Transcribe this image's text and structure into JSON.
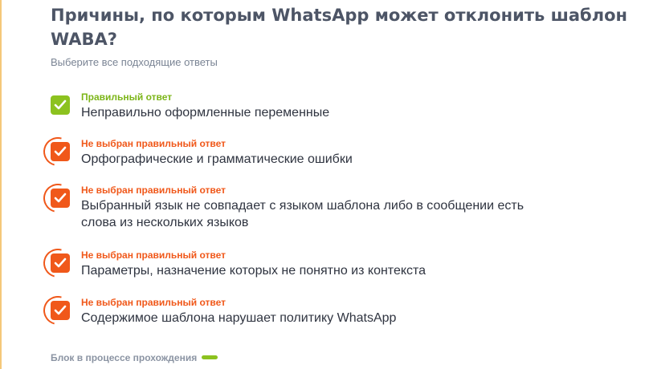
{
  "question": {
    "title": "Причины, по которым WhatsApp может отклонить шаблон WABA?",
    "instruction": "Выберите все подходящие ответы"
  },
  "answers": [
    {
      "status": "Правильный ответ",
      "text": "Неправильно оформленные переменные",
      "state": "correct"
    },
    {
      "status": "Не выбран правильный ответ",
      "text": "Орфографические и грамматические ошибки",
      "state": "missed"
    },
    {
      "status": "Не выбран правильный ответ",
      "text": "Выбранный язык не совпадает с языком шаблона либо в сообщении есть слова из нескольких языков",
      "state": "missed"
    },
    {
      "status": "Не выбран правильный ответ",
      "text": "Параметры, назначение которых не понятно из контекста",
      "state": "missed"
    },
    {
      "status": "Не выбран правильный ответ",
      "text": "Содержимое шаблона нарушает политику WhatsApp",
      "state": "missed"
    }
  ],
  "progress": {
    "label": "Блок в процессе прохождения"
  },
  "colors": {
    "correct": "#8cc21f",
    "missed": "#f0581a",
    "title": "#4d5566"
  }
}
